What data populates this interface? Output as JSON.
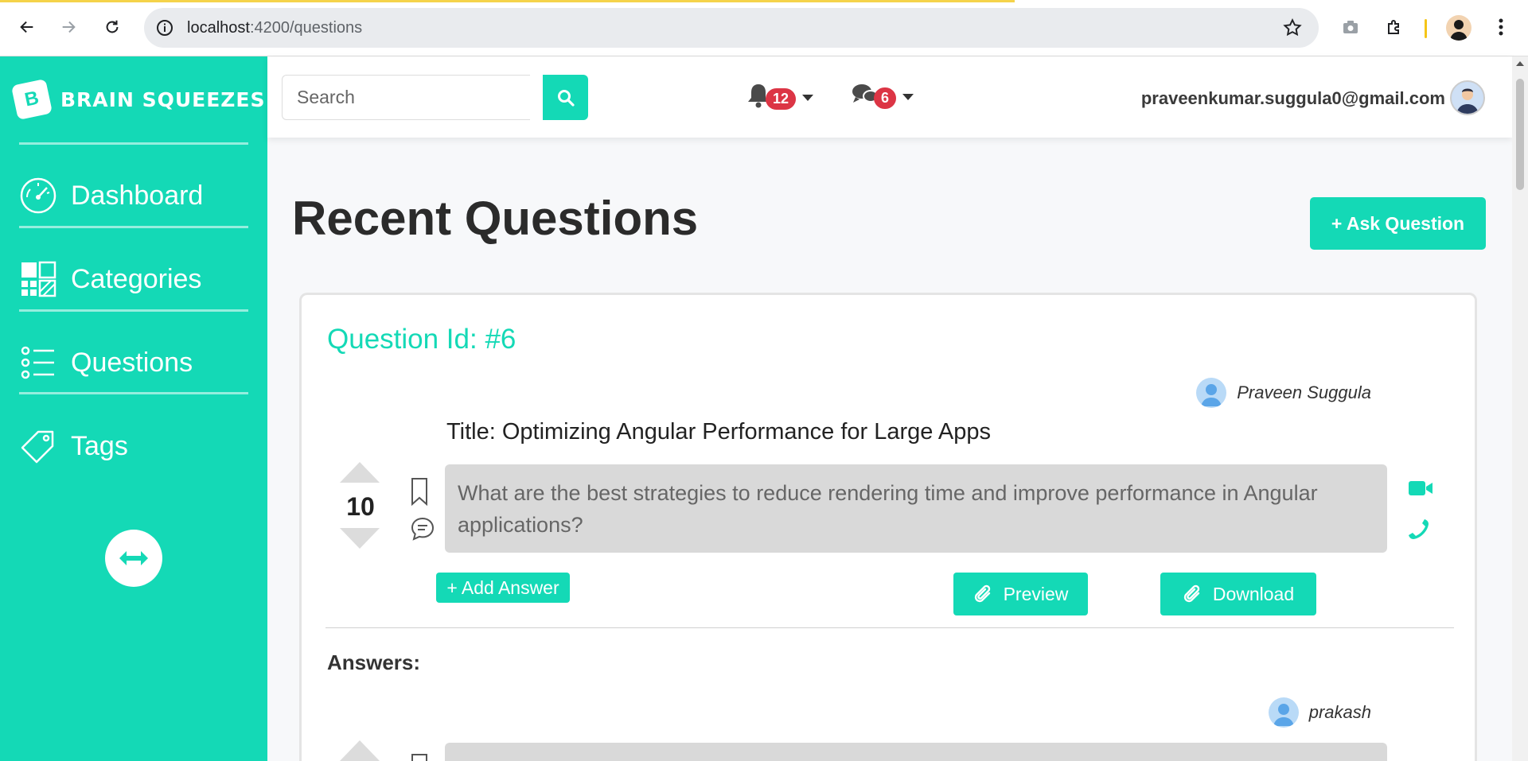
{
  "browser": {
    "url_host": "localhost",
    "url_path": ":4200/questions"
  },
  "sidebar": {
    "brand": "BRAIN SQUEEZES",
    "brand_letter": "B",
    "items": [
      {
        "label": "Dashboard",
        "icon": "speedometer-icon"
      },
      {
        "label": "Categories",
        "icon": "grid-icon"
      },
      {
        "label": "Questions",
        "icon": "list-icon"
      },
      {
        "label": "Tags",
        "icon": "tag-icon"
      }
    ]
  },
  "header": {
    "search_placeholder": "Search",
    "notifications_count": "12",
    "messages_count": "6",
    "user_email": "praveenkumar.suggula0@gmail.com"
  },
  "main": {
    "title": "Recent Questions",
    "ask_button": "+ Ask Question"
  },
  "question": {
    "id_label": "Question Id: #6",
    "author": "Praveen Suggula",
    "title": "Title: Optimizing Angular Performance for Large Apps",
    "votes": "10",
    "body": "What are the best strategies to reduce rendering time and improve performance in Angular applications?",
    "add_answer": "+ Add Answer",
    "preview": "Preview",
    "download": "Download"
  },
  "answers": {
    "label": "Answers:",
    "first_author": "prakash"
  },
  "colors": {
    "accent": "#14d9b6",
    "badge": "#dc3545"
  }
}
